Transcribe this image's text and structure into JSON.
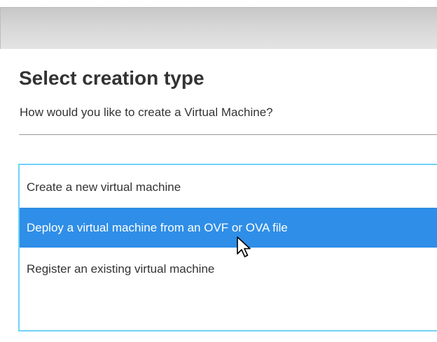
{
  "wizard": {
    "title": "Select creation type",
    "subtitle": "How would you like to create a Virtual Machine?"
  },
  "creation_options": {
    "items": [
      {
        "label": "Create a new virtual machine",
        "selected": false
      },
      {
        "label": "Deploy a virtual machine from an OVF or OVA file",
        "selected": true
      },
      {
        "label": "Register an existing virtual machine",
        "selected": false
      }
    ]
  },
  "colors": {
    "selection": "#2f8ee7",
    "focus_border": "#6fd3f7",
    "text": "#333333"
  },
  "icons": {
    "pointer": "mouse-pointer-icon"
  }
}
